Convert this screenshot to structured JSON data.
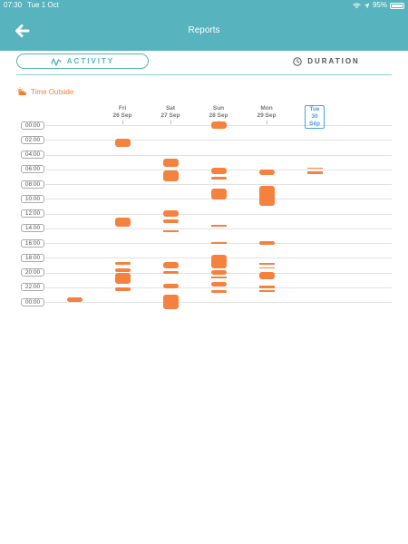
{
  "status_bar": {
    "time": "07:30",
    "date": "Tue 1 Oct",
    "battery": "95%"
  },
  "header": {
    "title": "Reports"
  },
  "tabs": {
    "activity": "ACTIVITY",
    "duration": "DURATION",
    "active": "activity"
  },
  "section": {
    "title": "Time Outside"
  },
  "colors": {
    "accent": "#57b3bd",
    "activity": "#f5813f",
    "today": "#4a9fe0"
  },
  "chart_data": {
    "type": "timeline",
    "y_axis_labels": [
      "00:00",
      "02:00",
      "04:00",
      "06:00",
      "08:00",
      "10:00",
      "12:00",
      "14:00",
      "16:00",
      "18:00",
      "20:00",
      "22:00",
      "00:00"
    ],
    "days": [
      {
        "day": "",
        "date": "",
        "today": false,
        "sessions": [
          [
            23.4,
            24.0
          ]
        ]
      },
      {
        "day": "Fri",
        "date": "26 Sep",
        "today": false,
        "sessions": [
          [
            1.8,
            2.9
          ],
          [
            12.5,
            13.8
          ],
          [
            18.6,
            19.0
          ],
          [
            19.4,
            19.9
          ],
          [
            20.1,
            21.5
          ],
          [
            22.0,
            22.5
          ]
        ]
      },
      {
        "day": "Sat",
        "date": "27 Sep",
        "today": false,
        "sessions": [
          [
            4.5,
            5.6
          ],
          [
            6.2,
            7.6
          ],
          [
            11.6,
            12.4
          ],
          [
            12.8,
            13.3
          ],
          [
            14.3,
            14.5
          ],
          [
            18.6,
            19.5
          ],
          [
            19.8,
            20.2
          ],
          [
            21.5,
            22.2
          ],
          [
            23.0,
            25.0
          ]
        ]
      },
      {
        "day": "Sun",
        "date": "28 Sep",
        "today": false,
        "sessions": [
          [
            -0.5,
            0.5
          ],
          [
            5.8,
            6.7
          ],
          [
            7.0,
            7.4
          ],
          [
            8.6,
            10.1
          ],
          [
            13.5,
            13.8
          ],
          [
            15.9,
            16.1
          ],
          [
            17.6,
            19.5
          ],
          [
            19.7,
            20.3
          ],
          [
            20.5,
            20.8
          ],
          [
            21.3,
            21.9
          ],
          [
            22.4,
            22.8
          ]
        ]
      },
      {
        "day": "Mon",
        "date": "29 Sep",
        "today": false,
        "sessions": [
          [
            6.0,
            6.8
          ],
          [
            8.3,
            11.0
          ],
          [
            15.7,
            16.2
          ],
          [
            18.7,
            18.9
          ],
          [
            19.3,
            19.5
          ],
          [
            19.9,
            20.9
          ],
          [
            21.8,
            22.1
          ],
          [
            22.4,
            22.7
          ]
        ]
      },
      {
        "day": "Tue",
        "date": "30 Sep",
        "today": true,
        "sessions": [
          [
            5.8,
            5.9
          ],
          [
            6.3,
            6.6
          ]
        ]
      }
    ]
  }
}
